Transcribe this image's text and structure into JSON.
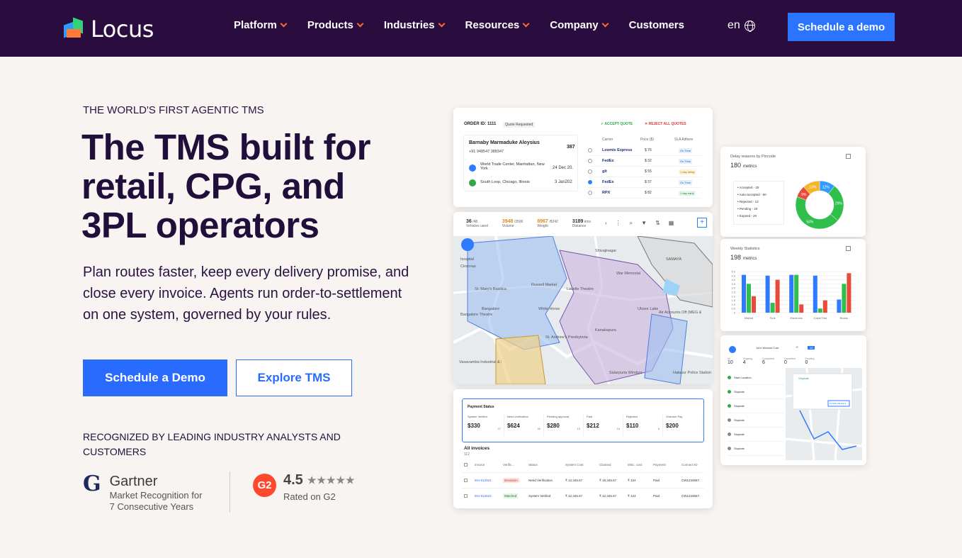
{
  "nav": {
    "logo_text": "Locus",
    "items": [
      {
        "label": "Platform",
        "has_dropdown": true
      },
      {
        "label": "Products",
        "has_dropdown": true
      },
      {
        "label": "Industries",
        "has_dropdown": true
      },
      {
        "label": "Resources",
        "has_dropdown": true
      },
      {
        "label": "Company",
        "has_dropdown": true
      },
      {
        "label": "Customers",
        "has_dropdown": false
      }
    ],
    "lang": "en",
    "cta": "Schedule a demo",
    "bg_color": "#2a0d3e",
    "accent_color": "#ff6a2a"
  },
  "hero": {
    "eyebrow": "THE WORLD'S FIRST AGENTIC TMS",
    "headline": "The TMS built for retail, CPG, and 3PL operators",
    "subheadline": "Plan routes faster, keep every delivery promise, and close every invoice. Agents run order-to-settlement on one system, governed by your rules.",
    "primary_cta": "Schedule a Demo",
    "secondary_cta": "Explore TMS",
    "recognized": "RECOGNIZED BY LEADING INDUSTRY ANALYSTS AND CUSTOMERS",
    "primary_color": "#2a6bff"
  },
  "badges": {
    "gartner": {
      "mark": "G",
      "name": "Gartner",
      "line1": "Market Recognition for",
      "line2": "7 Consecutive Years"
    },
    "g2": {
      "mark": "G2",
      "rating": "4.5",
      "stars": "★★★★★",
      "sub": "Rated on G2"
    }
  },
  "cards": {
    "order": {
      "order_id": "ORDER ID: 1111",
      "status": "Quote Requested",
      "accept": "✓ ACCEPT QUOTE",
      "reject": "✕ REJECT ALL QUOTES",
      "customer": "Barnaby Marmaduke Aloysius",
      "phone": "+91 948547 388347",
      "count": "387",
      "stops": [
        {
          "place": "World Trade Center, Manhattan, New York",
          "date": "24 Dec 20."
        },
        {
          "place": "South Loop, Chicago, Illinois",
          "date": "3 Jan202"
        }
      ],
      "columns": [
        "Carrier",
        "Price ($)",
        "SLA Adhere"
      ],
      "rows": [
        {
          "carrier": "Loomis Express",
          "price": "$ 76",
          "sla": "On Time"
        },
        {
          "carrier": "FedEx",
          "price": "$ 32",
          "sla": "On Time"
        },
        {
          "carrier": "glt",
          "price": "$ 55",
          "sla": "1 day delay"
        },
        {
          "carrier": "FedEx",
          "price": "$ 37",
          "sla": "On Time"
        },
        {
          "carrier": "RPX",
          "price": "$ 82",
          "sla": "1 day early"
        }
      ]
    },
    "map": {
      "stats": [
        {
          "value": "36",
          "total": "/48",
          "label": "Vehicles used",
          "color": "#333"
        },
        {
          "value": "3948",
          "total": "/3506",
          "label": "Volume",
          "color": "#e08a1e"
        },
        {
          "value": "8967",
          "total": "/8242",
          "label": "Weight",
          "color": "#e08a1e"
        },
        {
          "value": "3189",
          "total": "kms",
          "label": "Distance",
          "color": "#333"
        }
      ],
      "labels": [
        "hospital",
        "St. Mary's Basilica",
        "Bangalore",
        "Russell Market",
        "White Horse",
        "Bangalore Theatre",
        "Lavelle Theatre",
        "St. Andrew's Presbyterian Church",
        "Ulsoor Lake",
        "War Memorial",
        "Kanakapura",
        "Shivajinagar",
        "Air Accounts Off (MEG & Ce",
        "Salarpuria Windsor",
        "Halasur Police Station",
        "Vasavamba Industrial & Packaging Stores",
        "SAMAYA",
        "Cinemas"
      ]
    },
    "payments": {
      "title": "Payment Status",
      "stats": [
        {
          "label": "System Verified",
          "value": "$330",
          "count": "47"
        },
        {
          "label": "Need verification",
          "value": "$624",
          "count": "30"
        },
        {
          "label": "Pending approval",
          "value": "$280",
          "count": "15"
        },
        {
          "label": "Paid",
          "value": "$212",
          "count": "16"
        },
        {
          "label": "Rejected",
          "value": "$110",
          "count": "8"
        },
        {
          "label": "Overdue Pay",
          "value": "$200",
          "count": ""
        }
      ],
      "all_invoices": "All invoices",
      "all_count": "112",
      "columns": [
        "Invoice",
        "Verific...",
        "Status",
        "System Cost",
        "Claimed",
        "Misc. cost",
        "Payment",
        "Connect ID"
      ],
      "rows": [
        {
          "invoice": "INV-012521",
          "verif": "Deviation",
          "status": "Need Verification",
          "sys": "₹ 12,345.67",
          "claimed": "₹ 15,345.67",
          "misc": "₹ 124",
          "payment": "Paid",
          "connect": "CW1234567."
        },
        {
          "invoice": "INV-012522",
          "verif": "Matched",
          "status": "System Verified",
          "sys": "₹ 12,345.67",
          "claimed": "₹ 12,345.67",
          "misc": "₹ 124",
          "payment": "Paid",
          "connect": "CW1234567."
        }
      ]
    },
    "delay": {
      "title": "Delay reasons by Pincode",
      "metrics": "180",
      "metrics_label": "metrics",
      "legend": [
        "Accepted - 20",
        "Auto-accepted - 60",
        "Rejected - 13",
        "Pending - 20",
        "Expired - 20"
      ],
      "pie": [
        {
          "label": "12%",
          "value": 12,
          "color": "#2f9bff"
        },
        {
          "label": "29%",
          "value": 29,
          "color": "#2fbf4a"
        },
        {
          "label": "50%",
          "value": 50,
          "color": "#2fbf4a"
        },
        {
          "label": "9%",
          "value": 9,
          "color": "#ea4a3a"
        },
        {
          "label": "13%",
          "value": 13,
          "color": "#f5b52a"
        }
      ]
    },
    "weekly": {
      "title": "Weekly Statistics",
      "metrics": "198",
      "metrics_label": "metrics",
      "categories": [
        "Market",
        "Fruit",
        "Electronic",
        "Cake/Thai",
        "Books"
      ],
      "y_ticks": [
        "5.0",
        "4.5",
        "4.0",
        "3.5",
        "3.0",
        "2.5",
        "2.0",
        "1.5",
        "1.0",
        "0.5",
        "0"
      ],
      "series": [
        {
          "color": "#2f7bff",
          "values": [
            4.6,
            4.5,
            4.6,
            4.5,
            1.6
          ]
        },
        {
          "color": "#2fbf4a",
          "values": [
            3.5,
            1.2,
            4.6,
            0.5,
            3.5
          ]
        },
        {
          "color": "#ea4a3a",
          "values": [
            2.0,
            4.0,
            1.0,
            1.5,
            4.8
          ]
        }
      ]
    },
    "route": {
      "driver": "John Michael Carr",
      "time": "10",
      "stats": [
        {
          "label": "All",
          "value": "10"
        },
        {
          "label": "Ongoing",
          "value": "4"
        },
        {
          "label": "Completed",
          "value": "6"
        },
        {
          "label": "Cancelled",
          "value": "0"
        },
        {
          "label": "Pending",
          "value": "0"
        }
      ],
      "stops": [
        "Start Location",
        "Stoptate",
        "Stoptate",
        "Stoptate",
        "Stoptate",
        "Stoptate"
      ],
      "popup_title": "Stoptate",
      "popup_btn": "STOPE DETAILS"
    }
  }
}
